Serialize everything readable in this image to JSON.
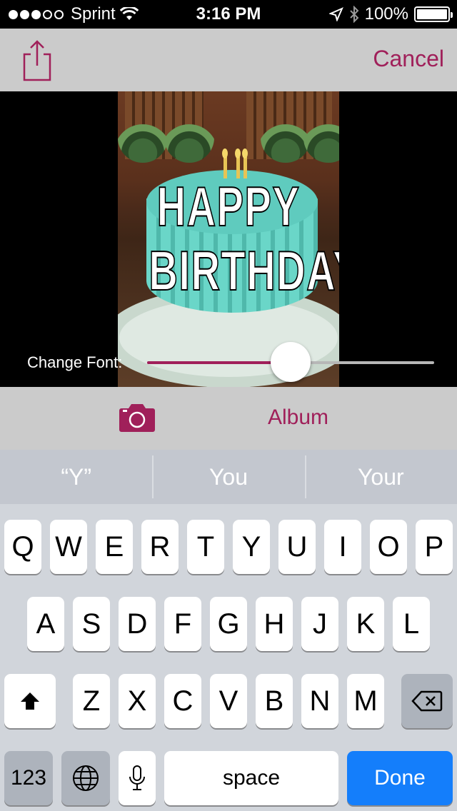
{
  "status_bar": {
    "carrier": "Sprint",
    "time": "3:16 PM",
    "battery": "100%"
  },
  "nav": {
    "share_icon": "share-icon",
    "cancel_label": "Cancel"
  },
  "meme": {
    "top_text": "HAPPY",
    "bottom_text": "BIRTHDAY"
  },
  "slider": {
    "label": "Change Font:",
    "value": 0.5
  },
  "toolbar": {
    "camera_icon": "camera-icon",
    "album_label": "Album"
  },
  "keyboard": {
    "suggestions": [
      "“Y”",
      "You",
      "Your"
    ],
    "row1": [
      "Q",
      "W",
      "E",
      "R",
      "T",
      "Y",
      "U",
      "I",
      "O",
      "P"
    ],
    "row2": [
      "A",
      "S",
      "D",
      "F",
      "G",
      "H",
      "J",
      "K",
      "L"
    ],
    "row3": [
      "Z",
      "X",
      "C",
      "V",
      "B",
      "N",
      "M"
    ],
    "numbers_label": "123",
    "space_label": "space",
    "done_label": "Done"
  },
  "colors": {
    "accent": "#a0205a",
    "done": "#147efb"
  }
}
